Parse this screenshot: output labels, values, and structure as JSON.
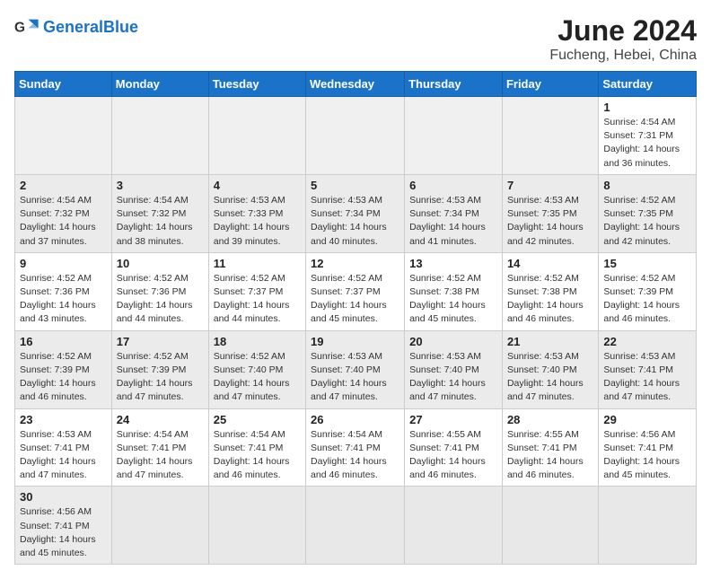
{
  "header": {
    "logo_general": "General",
    "logo_blue": "Blue",
    "title": "June 2024",
    "location": "Fucheng, Hebei, China"
  },
  "weekdays": [
    "Sunday",
    "Monday",
    "Tuesday",
    "Wednesday",
    "Thursday",
    "Friday",
    "Saturday"
  ],
  "weeks": [
    {
      "shade": "shade-1",
      "days": [
        {
          "num": "",
          "info": "",
          "empty": true
        },
        {
          "num": "",
          "info": "",
          "empty": true
        },
        {
          "num": "",
          "info": "",
          "empty": true
        },
        {
          "num": "",
          "info": "",
          "empty": true
        },
        {
          "num": "",
          "info": "",
          "empty": true
        },
        {
          "num": "",
          "info": "",
          "empty": true
        },
        {
          "num": "1",
          "info": "Sunrise: 4:54 AM\nSunset: 7:31 PM\nDaylight: 14 hours and 36 minutes.",
          "empty": false
        }
      ]
    },
    {
      "shade": "shade-2",
      "days": [
        {
          "num": "2",
          "info": "Sunrise: 4:54 AM\nSunset: 7:32 PM\nDaylight: 14 hours and 37 minutes.",
          "empty": false
        },
        {
          "num": "3",
          "info": "Sunrise: 4:54 AM\nSunset: 7:32 PM\nDaylight: 14 hours and 38 minutes.",
          "empty": false
        },
        {
          "num": "4",
          "info": "Sunrise: 4:53 AM\nSunset: 7:33 PM\nDaylight: 14 hours and 39 minutes.",
          "empty": false
        },
        {
          "num": "5",
          "info": "Sunrise: 4:53 AM\nSunset: 7:34 PM\nDaylight: 14 hours and 40 minutes.",
          "empty": false
        },
        {
          "num": "6",
          "info": "Sunrise: 4:53 AM\nSunset: 7:34 PM\nDaylight: 14 hours and 41 minutes.",
          "empty": false
        },
        {
          "num": "7",
          "info": "Sunrise: 4:53 AM\nSunset: 7:35 PM\nDaylight: 14 hours and 42 minutes.",
          "empty": false
        },
        {
          "num": "8",
          "info": "Sunrise: 4:52 AM\nSunset: 7:35 PM\nDaylight: 14 hours and 42 minutes.",
          "empty": false
        }
      ]
    },
    {
      "shade": "shade-1",
      "days": [
        {
          "num": "9",
          "info": "Sunrise: 4:52 AM\nSunset: 7:36 PM\nDaylight: 14 hours and 43 minutes.",
          "empty": false
        },
        {
          "num": "10",
          "info": "Sunrise: 4:52 AM\nSunset: 7:36 PM\nDaylight: 14 hours and 44 minutes.",
          "empty": false
        },
        {
          "num": "11",
          "info": "Sunrise: 4:52 AM\nSunset: 7:37 PM\nDaylight: 14 hours and 44 minutes.",
          "empty": false
        },
        {
          "num": "12",
          "info": "Sunrise: 4:52 AM\nSunset: 7:37 PM\nDaylight: 14 hours and 45 minutes.",
          "empty": false
        },
        {
          "num": "13",
          "info": "Sunrise: 4:52 AM\nSunset: 7:38 PM\nDaylight: 14 hours and 45 minutes.",
          "empty": false
        },
        {
          "num": "14",
          "info": "Sunrise: 4:52 AM\nSunset: 7:38 PM\nDaylight: 14 hours and 46 minutes.",
          "empty": false
        },
        {
          "num": "15",
          "info": "Sunrise: 4:52 AM\nSunset: 7:39 PM\nDaylight: 14 hours and 46 minutes.",
          "empty": false
        }
      ]
    },
    {
      "shade": "shade-2",
      "days": [
        {
          "num": "16",
          "info": "Sunrise: 4:52 AM\nSunset: 7:39 PM\nDaylight: 14 hours and 46 minutes.",
          "empty": false
        },
        {
          "num": "17",
          "info": "Sunrise: 4:52 AM\nSunset: 7:39 PM\nDaylight: 14 hours and 47 minutes.",
          "empty": false
        },
        {
          "num": "18",
          "info": "Sunrise: 4:52 AM\nSunset: 7:40 PM\nDaylight: 14 hours and 47 minutes.",
          "empty": false
        },
        {
          "num": "19",
          "info": "Sunrise: 4:53 AM\nSunset: 7:40 PM\nDaylight: 14 hours and 47 minutes.",
          "empty": false
        },
        {
          "num": "20",
          "info": "Sunrise: 4:53 AM\nSunset: 7:40 PM\nDaylight: 14 hours and 47 minutes.",
          "empty": false
        },
        {
          "num": "21",
          "info": "Sunrise: 4:53 AM\nSunset: 7:40 PM\nDaylight: 14 hours and 47 minutes.",
          "empty": false
        },
        {
          "num": "22",
          "info": "Sunrise: 4:53 AM\nSunset: 7:41 PM\nDaylight: 14 hours and 47 minutes.",
          "empty": false
        }
      ]
    },
    {
      "shade": "shade-1",
      "days": [
        {
          "num": "23",
          "info": "Sunrise: 4:53 AM\nSunset: 7:41 PM\nDaylight: 14 hours and 47 minutes.",
          "empty": false
        },
        {
          "num": "24",
          "info": "Sunrise: 4:54 AM\nSunset: 7:41 PM\nDaylight: 14 hours and 47 minutes.",
          "empty": false
        },
        {
          "num": "25",
          "info": "Sunrise: 4:54 AM\nSunset: 7:41 PM\nDaylight: 14 hours and 46 minutes.",
          "empty": false
        },
        {
          "num": "26",
          "info": "Sunrise: 4:54 AM\nSunset: 7:41 PM\nDaylight: 14 hours and 46 minutes.",
          "empty": false
        },
        {
          "num": "27",
          "info": "Sunrise: 4:55 AM\nSunset: 7:41 PM\nDaylight: 14 hours and 46 minutes.",
          "empty": false
        },
        {
          "num": "28",
          "info": "Sunrise: 4:55 AM\nSunset: 7:41 PM\nDaylight: 14 hours and 46 minutes.",
          "empty": false
        },
        {
          "num": "29",
          "info": "Sunrise: 4:56 AM\nSunset: 7:41 PM\nDaylight: 14 hours and 45 minutes.",
          "empty": false
        }
      ]
    },
    {
      "shade": "shade-2",
      "days": [
        {
          "num": "30",
          "info": "Sunrise: 4:56 AM\nSunset: 7:41 PM\nDaylight: 14 hours and 45 minutes.",
          "empty": false
        },
        {
          "num": "",
          "info": "",
          "empty": true
        },
        {
          "num": "",
          "info": "",
          "empty": true
        },
        {
          "num": "",
          "info": "",
          "empty": true
        },
        {
          "num": "",
          "info": "",
          "empty": true
        },
        {
          "num": "",
          "info": "",
          "empty": true
        },
        {
          "num": "",
          "info": "",
          "empty": true
        }
      ]
    }
  ]
}
